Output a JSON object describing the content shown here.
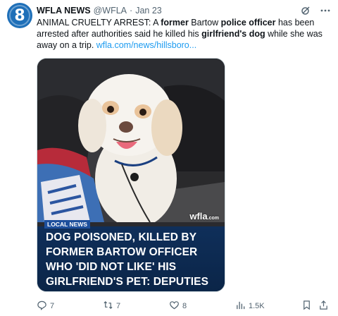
{
  "account": {
    "avatar_glyph": "8",
    "name": "WFLA NEWS",
    "handle": "@WFLA",
    "separator": "·",
    "time": "Jan 23"
  },
  "tweet": {
    "segments": [
      {
        "t": "ANIMAL CRUELTY ARREST: A ",
        "b": false
      },
      {
        "t": "former",
        "b": true
      },
      {
        "t": " Bartow ",
        "b": false
      },
      {
        "t": "police officer",
        "b": true
      },
      {
        "t": " has been arrested after authorities said he killed his ",
        "b": false
      },
      {
        "t": "girlfriend's dog",
        "b": true
      },
      {
        "t": " while she was away on a trip. ",
        "b": false
      }
    ],
    "link": "wfla.com/news/hillsboro..."
  },
  "media": {
    "badge": "LOCAL NEWS",
    "watermark": "wfla",
    "watermark_suffix": ".com",
    "headline_lines": [
      "DOG POISONED, KILLED BY",
      "FORMER BARTOW OFFICER",
      "WHO 'DID NOT LIKE' HIS",
      "GIRLFRIEND'S PET: DEPUTIES"
    ]
  },
  "actions": {
    "replies": "7",
    "reposts": "7",
    "likes": "8",
    "views": "1.5K"
  },
  "icons": [
    "grok-icon",
    "more-icon",
    "reply-icon",
    "repost-icon",
    "like-icon",
    "views-icon",
    "bookmark-icon",
    "share-icon"
  ],
  "colors": {
    "link": "#1d9bf0",
    "muted": "#536471",
    "headline_bg": "#0f2f5a",
    "avatar": "#1e6fb8"
  }
}
